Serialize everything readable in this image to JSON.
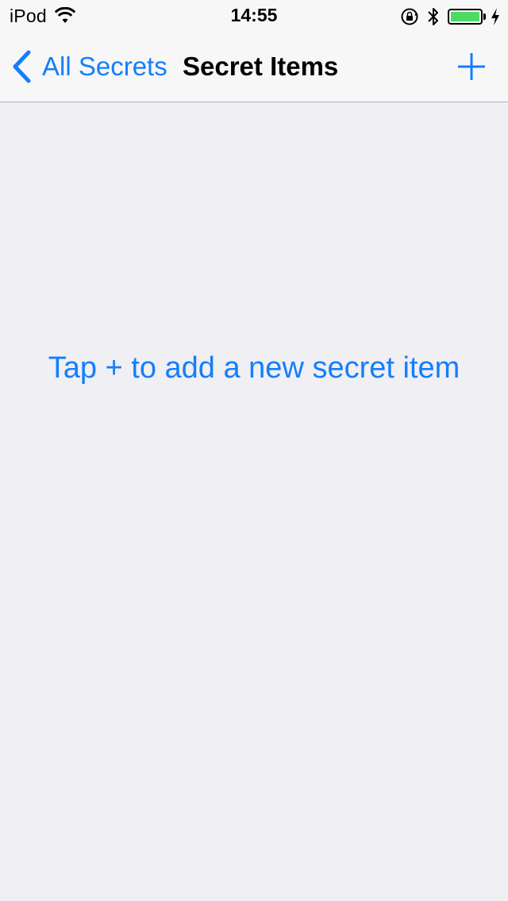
{
  "status_bar": {
    "carrier": "iPod",
    "time": "14:55",
    "battery_level": 1.0,
    "icons": [
      "wifi-icon",
      "rotation-lock-icon",
      "bluetooth-icon",
      "battery-icon",
      "charging-bolt-icon"
    ],
    "battery_color": "#4cd964"
  },
  "nav": {
    "back_label": "All Secrets",
    "title": "Secret Items",
    "add_icon": "plus-icon",
    "back_icon": "chevron-left-icon",
    "accent": "#157efb"
  },
  "empty_state": {
    "message": "Tap + to add a new secret item"
  }
}
